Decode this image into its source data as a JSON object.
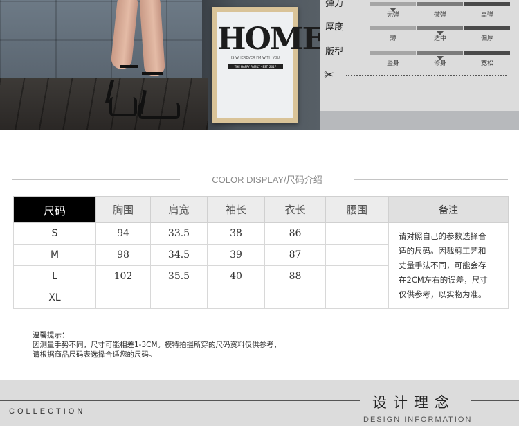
{
  "banner": {
    "frame_title": "HOME",
    "frame_subtitle": "IS WHEREVER I'M WITH YOU",
    "frame_band": "THE HAPPY FAMILY · EST. 2017"
  },
  "spec": {
    "rows": [
      {
        "label": "弹力",
        "options": [
          "无弹",
          "微弹",
          "高弹"
        ],
        "selected_index": 0
      },
      {
        "label": "厚度",
        "options": [
          "薄",
          "适中",
          "偏厚"
        ],
        "selected_index": 1
      },
      {
        "label": "版型",
        "options": [
          "竖身",
          "修身",
          "宽松"
        ],
        "selected_index": 1
      }
    ],
    "bar_colors": [
      "#a6a6a6",
      "#7c7c7c",
      "#4a4a4a"
    ]
  },
  "heading": "COLOR DISPLAY/尺码介绍",
  "size_table": {
    "headers": [
      "尺码",
      "胸围",
      "肩宽",
      "袖长",
      "衣长",
      "腰围",
      "备注"
    ],
    "rows": [
      {
        "size": "S",
        "chest": "94",
        "shoulder": "33.5",
        "sleeve": "38",
        "length": "86",
        "waist": ""
      },
      {
        "size": "M",
        "chest": "98",
        "shoulder": "34.5",
        "sleeve": "39",
        "length": "87",
        "waist": ""
      },
      {
        "size": "L",
        "chest": "102",
        "shoulder": "35.5",
        "sleeve": "40",
        "length": "88",
        "waist": ""
      },
      {
        "size": "XL",
        "chest": "",
        "shoulder": "",
        "sleeve": "",
        "length": "",
        "waist": ""
      }
    ],
    "remark_lines": [
      "请对照自己的参数选择合",
      "适的尺码。因裁剪工艺和",
      "丈量手法不同，可能会存",
      "在2CM左右的误差，尺寸",
      "仅供参考，以实物为准。"
    ]
  },
  "tips": {
    "title": "温馨提示：",
    "line1": "因测量手势不同，尺寸可能相差1-3CM。模特拍摄所穿的尺码资料仅供参考，",
    "line2": "请根据商品尺码表选择合适您的尺码。"
  },
  "footer": {
    "collection": "COLLECTION",
    "design_title": "设计理念",
    "design_subtitle": "DESIGN INFORMATION"
  }
}
